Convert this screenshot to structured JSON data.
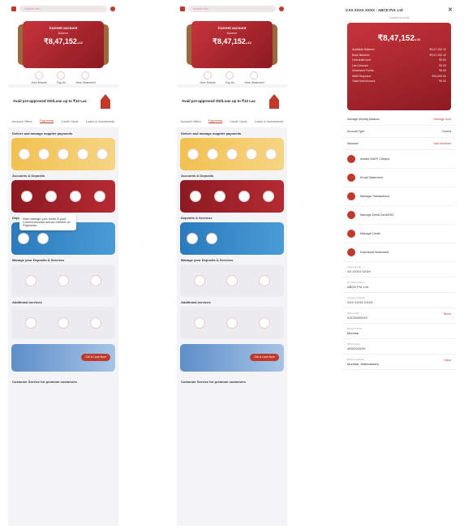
{
  "home": {
    "search_placeholder": "Search for...",
    "card": {
      "title": "Current account",
      "subtitle": "Balance",
      "amount": "₹8,47,152.",
      "amount_small": "12"
    },
    "card_actions": [
      "View Details",
      "Pay All",
      "View Statement"
    ],
    "promo_text": "Avail pre-approved OD/Loan up to ₹10 Lac",
    "tabs": [
      "Account Offers",
      "Payments",
      "Credit Cards",
      "Loans & Investments"
    ],
    "active_tab_index": 1,
    "sec1": "Deliver and manage supplier payments",
    "tooltip": "Now manage your funds & your Current Account across Internet on Payments",
    "sec2": "Accounts & Deposits",
    "sec3": "Deposits & Services",
    "sec4": "Manage your Deposits & Services",
    "sec5": "Additional services",
    "cta_text": "Get a Loan Now",
    "sec6": "Customer Service for premium customers"
  },
  "detail": {
    "title": "CAX XXXX XXXX - ABCD Pvt. Ltd",
    "subtitle": "Current Account",
    "amount": "₹8,47,152.",
    "amount_small": "12",
    "rows": [
      [
        "Available Balance",
        "₹8,47,152.12"
      ],
      [
        "Book Balance",
        "₹8,47,152.12"
      ],
      [
        "Overdraft Limit",
        "₹0.00"
      ],
      [
        "Lien Amount",
        "₹0.00"
      ],
      [
        "Uncleared Funds",
        "₹0.00"
      ],
      [
        "MAB Required",
        "₹25,000.00"
      ],
      [
        "Total Hold Amount",
        "₹0.00"
      ]
    ],
    "line1_label": "Average Monthly Balance",
    "line1_value": "Manage Limit",
    "line2_label": "Account Type",
    "line2_value": "Current",
    "line3_label": "Nominee",
    "line3_value": "Add Nominee",
    "menu": [
      "Instant MICR Cheque",
      "Email Statement",
      "Manage Transactions",
      "Manage Debit Card/DSC",
      "Manage Limits",
      "Download Statement"
    ],
    "fields": [
      [
        "Customer ID",
        "XX XXXX XXXX"
      ],
      [
        "Company Name",
        "ABCD Pvt. Ltd"
      ],
      [
        "Account Number",
        "XXX XXXX XXXX"
      ],
      [
        "IFSC Code",
        "ICIC0000XXX"
      ],
      [
        "Branch Name",
        "Mumbai"
      ],
      [
        "MICR Code",
        "400XXXXXX"
      ],
      [
        "Branch Address",
        "Mumbai, Maharashtra"
      ]
    ],
    "more_label": "More",
    "view_label": "View"
  }
}
